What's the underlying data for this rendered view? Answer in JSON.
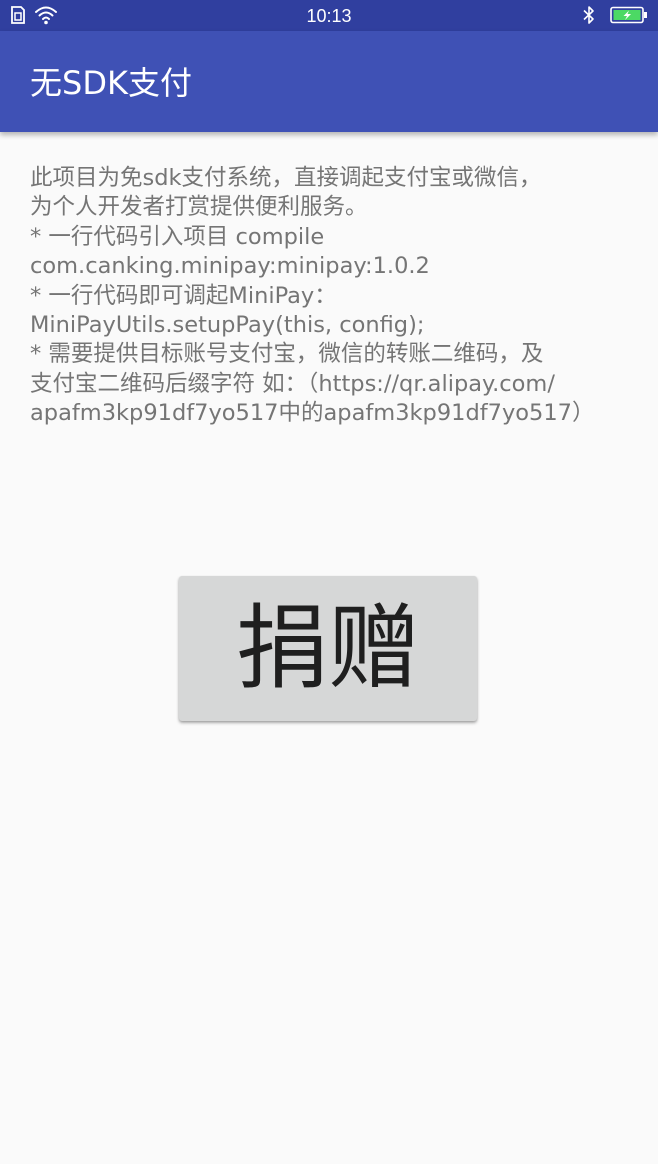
{
  "status_bar": {
    "time": "10:13",
    "icons": [
      "sim-card-icon",
      "wifi-icon",
      "bluetooth-icon",
      "battery-charging-icon"
    ],
    "background": "#303f9f"
  },
  "app_bar": {
    "title": "无SDK支付",
    "background": "#3f51b5"
  },
  "description": {
    "lines": [
      "此项目为免sdk支付系统，直接调起支付宝或微信，",
      "为个人开发者打赏提供便利服务。",
      " * 一行代码引入项目 compile",
      "com.canking.minipay:minipay:1.0.2",
      " * 一行代码即可调起MiniPay：",
      "MiniPayUtils.setupPay(this, config);",
      " * 需要提供目标账号支付宝，微信的转账二维码，及",
      "支付宝二维码后缀字符 如：（https://qr.alipay.com/",
      "apafm3kp91df7yo517中的apafm3kp91df7yo517）"
    ]
  },
  "donate_button": {
    "label": "捐赠",
    "background": "#d6d7d7"
  }
}
